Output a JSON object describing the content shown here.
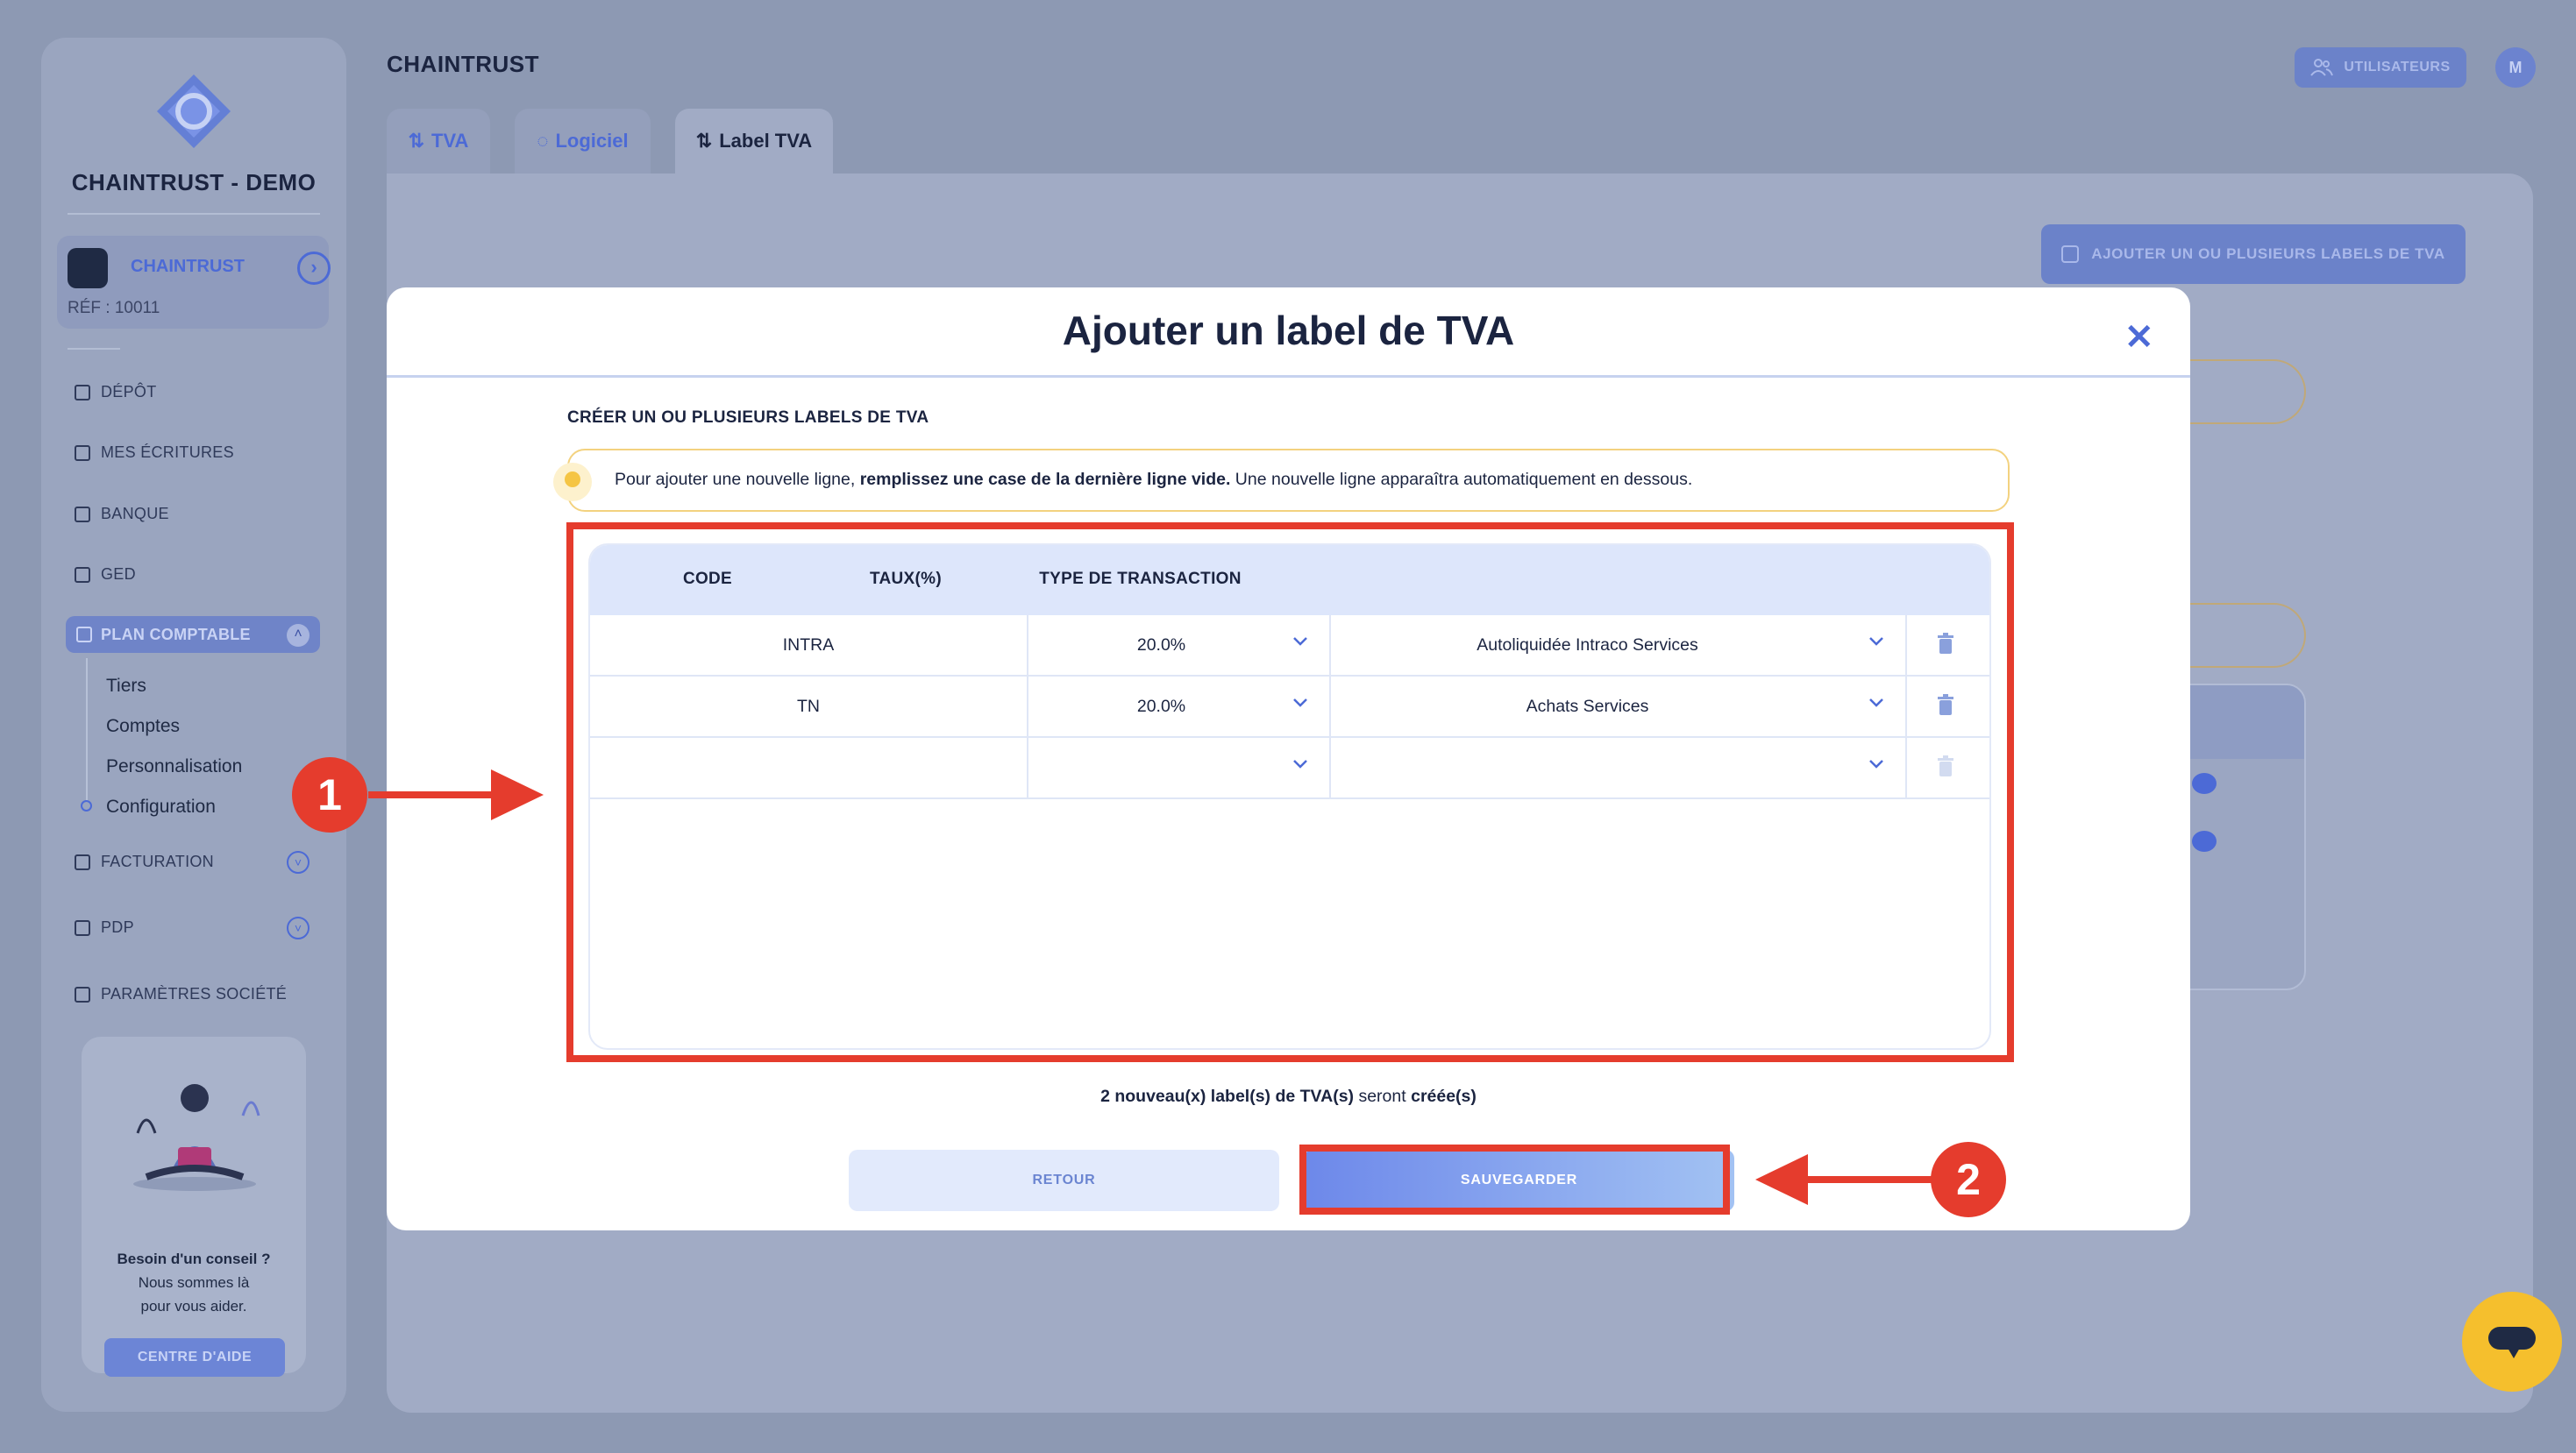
{
  "sidebar": {
    "company": "CHAINTRUST - DEMO",
    "org_name": "CHAINTRUST",
    "org_ref": "RÉF : 10011",
    "nav": {
      "depot": "DÉPÔT",
      "ecritures": "MES ÉCRITURES",
      "banque": "BANQUE",
      "ged": "GED",
      "plan_comptable": "PLAN COMPTABLE",
      "facturation": "FACTURATION",
      "pdp": "PDP",
      "parametres": "PARAMÈTRES SOCIÉTÉ"
    },
    "sub_items": [
      "Tiers",
      "Comptes",
      "Personnalisation",
      "Configuration"
    ],
    "help": {
      "line1": "Besoin d'un conseil ?",
      "line2": "Nous sommes là",
      "line3": "pour vous aider.",
      "button": "CENTRE D'AIDE"
    }
  },
  "header": {
    "title": "CHAINTRUST",
    "users_button": "UTILISATEURS",
    "avatar_initial": "M"
  },
  "tabs": [
    "TVA",
    "Logiciel",
    "Label TVA"
  ],
  "background": {
    "add_button": "AJOUTER UN OU PLUSIEURS LABELS DE TVA"
  },
  "modal": {
    "title": "Ajouter un label de TVA",
    "section_label": "CRÉER UN OU PLUSIEURS LABELS DE TVA",
    "info_part1": "Pour ajouter une nouvelle ligne, ",
    "info_bold": "remplissez une case de la dernière ligne vide.",
    "info_part2": " Une nouvelle ligne apparaîtra automatiquement en dessous.",
    "columns": [
      "CODE",
      "TAUX(%)",
      "TYPE DE TRANSACTION"
    ],
    "rows": [
      {
        "code": "INTRA",
        "taux": "20.0%",
        "type": "Autoliquidée Intraco Services"
      },
      {
        "code": "TN",
        "taux": "20.0%",
        "type": "Achats Services"
      },
      {
        "code": "",
        "taux": "",
        "type": ""
      }
    ],
    "summary_bold1": "2 nouveau(x) label(s) de TVA(s)",
    "summary_mid": " seront ",
    "summary_bold2": "créée(s)",
    "back_button": "RETOUR",
    "save_button": "SAUVEGARDER"
  },
  "annotations": {
    "badge1": "1",
    "badge2": "2",
    "color": "#e53c2d"
  },
  "colors": {
    "accent": "#4c6ad6",
    "overlay": "#8d99b3"
  }
}
